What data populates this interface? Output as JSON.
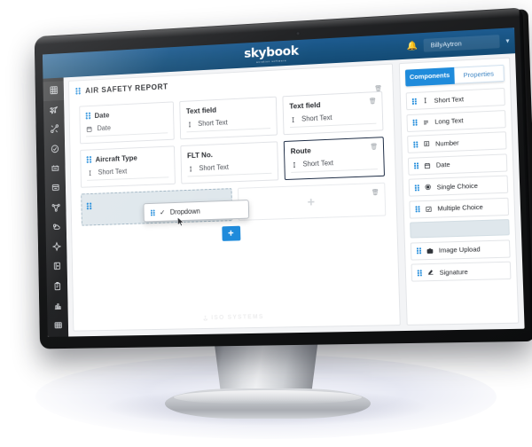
{
  "brand": {
    "name": "skybook",
    "tagline": "aviation software"
  },
  "topbar": {
    "notification_icon": "bell-icon",
    "user_name": "BillyAytron",
    "caret_icon": "chevron-down-icon"
  },
  "sidebar": {
    "items": [
      {
        "label": "Dashboard",
        "icon": "grid-icon",
        "active": true
      },
      {
        "label": "Flights",
        "icon": "airplane-icon"
      },
      {
        "label": "Crew Routing",
        "icon": "route-icon"
      },
      {
        "label": "Compliance",
        "icon": "badge-check-icon"
      },
      {
        "label": "Fleet",
        "icon": "hangar-icon"
      },
      {
        "label": "Records",
        "icon": "archive-icon"
      },
      {
        "label": "Network",
        "icon": "network-icon"
      },
      {
        "label": "Weather",
        "icon": "weather-icon"
      },
      {
        "label": "Navigation",
        "icon": "compass-icon"
      },
      {
        "label": "Documents",
        "icon": "document-icon"
      },
      {
        "label": "Forms",
        "icon": "clipboard-icon"
      },
      {
        "label": "Reports",
        "icon": "bar-chart-icon"
      },
      {
        "label": "Modules",
        "icon": "table-icon"
      }
    ]
  },
  "form": {
    "title": "AIR SAFETY REPORT",
    "section_delete_icon": "trash-icon",
    "rows": [
      {
        "fields": [
          {
            "label": "Date",
            "icon": "calendar-icon",
            "placeholder": "Date",
            "handle": true,
            "selected": false,
            "trash": false
          },
          {
            "label": "Text field",
            "icon": "text-cursor-icon",
            "placeholder": "Short Text",
            "handle": false,
            "selected": false,
            "trash": false
          },
          {
            "label": "Text field",
            "icon": "text-cursor-icon",
            "placeholder": "Short Text",
            "handle": false,
            "selected": false,
            "trash": true
          }
        ]
      },
      {
        "fields": [
          {
            "label": "Aircraft Type",
            "icon": "text-cursor-icon",
            "placeholder": "Short Text",
            "handle": true,
            "selected": false,
            "trash": false
          },
          {
            "label": "FLT No.",
            "icon": "text-cursor-icon",
            "placeholder": "Short Text",
            "handle": false,
            "selected": false,
            "trash": false
          },
          {
            "label": "Route",
            "icon": "text-cursor-icon",
            "placeholder": "Short Text",
            "handle": false,
            "selected": true,
            "trash": true
          }
        ]
      }
    ],
    "drag": {
      "dropzone_handle": "drag-handle-icon",
      "chip_label": "Dropdown",
      "chip_check_icon": "check-icon",
      "chip_handle_icon": "drag-handle-icon",
      "empty_card_plus": "+",
      "empty_card_trash": "trash-icon"
    },
    "add_button_label": "+",
    "watermark": "ISO SYSTEMS"
  },
  "panel": {
    "tabs": [
      {
        "label": "Components",
        "active": true
      },
      {
        "label": "Properties",
        "active": false
      }
    ],
    "components": [
      {
        "label": "Short Text",
        "icon": "text-cursor-icon",
        "placeholder": false
      },
      {
        "label": "Long Text",
        "icon": "lines-icon",
        "placeholder": false
      },
      {
        "label": "Number",
        "icon": "number-icon",
        "placeholder": false
      },
      {
        "label": "Date",
        "icon": "calendar-icon",
        "placeholder": false
      },
      {
        "label": "Single Choice",
        "icon": "radio-icon",
        "placeholder": false
      },
      {
        "label": "Multiple Choice",
        "icon": "checkbox-icon",
        "placeholder": false
      },
      {
        "label": "",
        "icon": "dropdown-placeholder",
        "placeholder": true
      },
      {
        "label": "Image Upload",
        "icon": "camera-icon",
        "placeholder": false
      },
      {
        "label": "Signature",
        "icon": "signature-icon",
        "placeholder": false
      }
    ]
  },
  "colors": {
    "topbar_navy": "#17527f",
    "accent_blue": "#1f8bdb",
    "rail_dark": "#1a1b1d",
    "selected_border": "#1c2b44",
    "dropzone_fill": "#dfe7ec"
  }
}
